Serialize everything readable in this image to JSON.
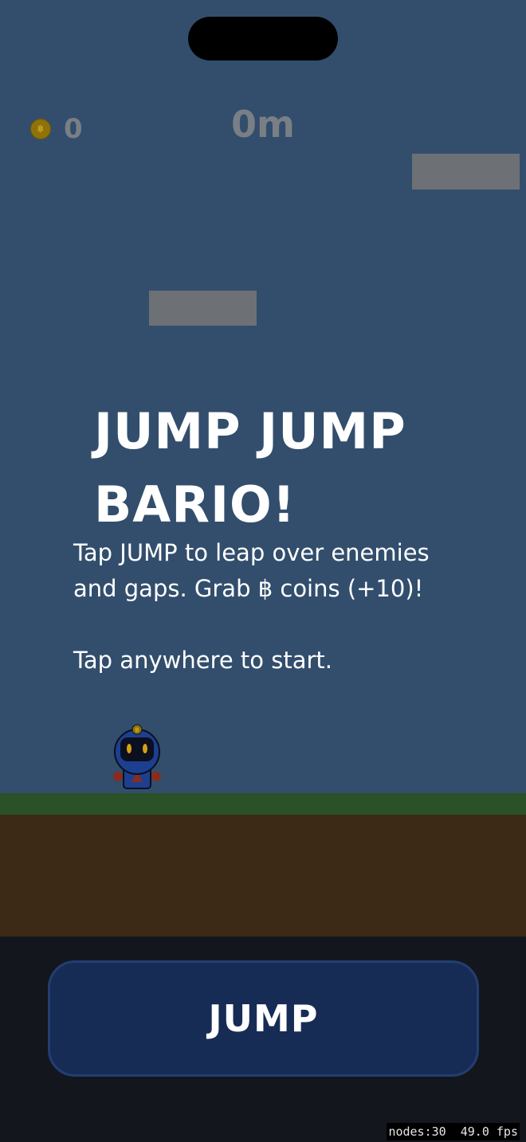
{
  "hud": {
    "coin_symbol": "฿",
    "coin_count": "0",
    "distance": "0m"
  },
  "title": {
    "line1": "JUMP JUMP",
    "line2": "BARIO!"
  },
  "instructions": {
    "line1": "Tap JUMP to leap over enemies",
    "line2": "and gaps. Grab ฿ coins (+10)!",
    "line3": "Tap anywhere to start."
  },
  "player": {
    "badge": "฿"
  },
  "controls": {
    "jump_label": "JUMP"
  },
  "debug": {
    "stats": "nodes:30  49.0 fps"
  },
  "colors": {
    "sky": "#324e6c",
    "platform": "#6d7075",
    "grass": "#2a5128",
    "dirt": "#3c2916",
    "control_bg": "#13161c",
    "jump_button": "#172c54",
    "coin": "#8f7309"
  }
}
